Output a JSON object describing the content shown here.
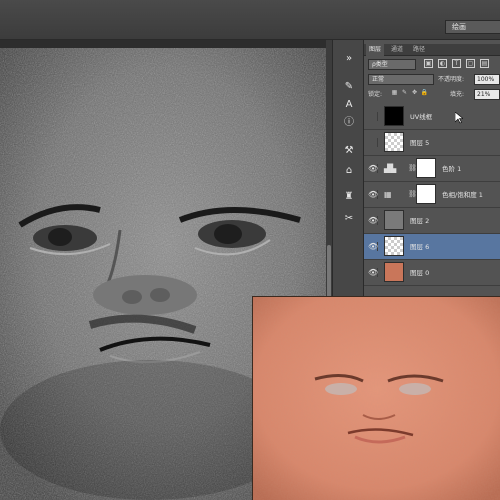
{
  "app": {
    "workspace_label": "绘画"
  },
  "panel": {
    "tabs": [
      {
        "label": "图层",
        "active": true
      },
      {
        "label": "通道",
        "active": false
      },
      {
        "label": "路径",
        "active": false
      }
    ],
    "filter_label": "ρ类型",
    "blend_mode": "正常",
    "opacity_label": "不透明度:",
    "opacity_value": "100%",
    "lock_label": "锁定:",
    "fill_label": "填充:",
    "fill_value": "21%"
  },
  "layers": [
    {
      "name": "UV线框",
      "visible": false,
      "thumb": "black",
      "selected": false
    },
    {
      "name": "图层 5",
      "visible": false,
      "thumb": "checker",
      "selected": false
    },
    {
      "name": "色阶 1",
      "visible": true,
      "thumb": "adjustment-levels",
      "mask": true,
      "selected": false
    },
    {
      "name": "色相/饱和度 1",
      "visible": true,
      "thumb": "adjustment-hue",
      "mask": true,
      "selected": false
    },
    {
      "name": "图层 2",
      "visible": true,
      "thumb": "gray",
      "selected": false
    },
    {
      "name": "图层 6",
      "visible": true,
      "thumb": "checker",
      "selected": true
    },
    {
      "name": "图层 0",
      "visible": true,
      "thumb": "skin",
      "selected": false
    }
  ],
  "colors": {
    "selected_layer": "#5876a0",
    "panel_bg": "#535353",
    "skin_tone": "#d9866a"
  }
}
